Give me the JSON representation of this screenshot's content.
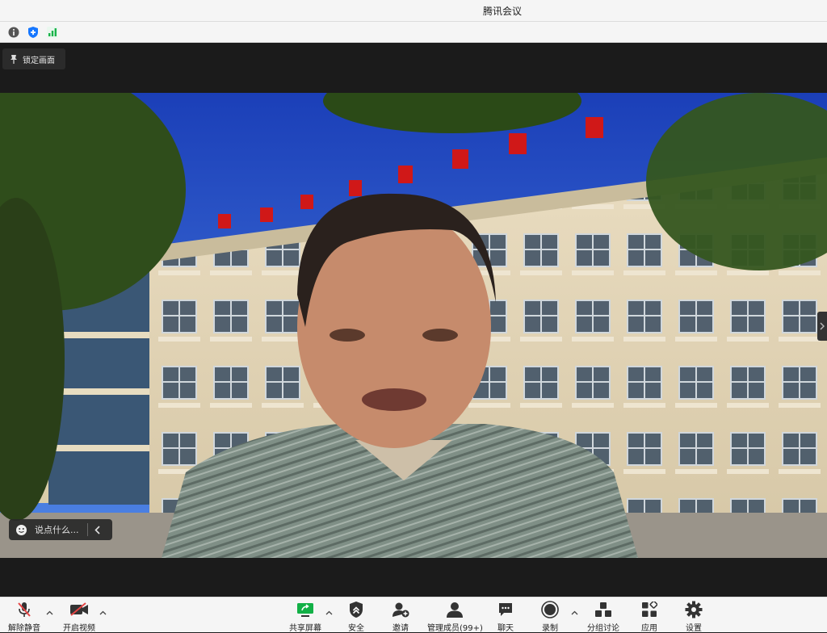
{
  "window": {
    "title": "腾讯会议"
  },
  "status_icons": [
    "info-icon",
    "shield-icon",
    "signal-bars-icon"
  ],
  "stage": {
    "lock_label": "锁定画面",
    "chat_placeholder": "说点什么..."
  },
  "toolbar": {
    "unmute": "解除静音",
    "start_video": "开启视频",
    "share_screen": "共享屏幕",
    "security": "安全",
    "invite": "邀请",
    "members": "管理成员(99+)",
    "chat": "聊天",
    "record": "录制",
    "breakout": "分组讨论",
    "apps": "应用",
    "settings": "设置"
  },
  "colors": {
    "share_green": "#12b046",
    "mute_red": "#e64545",
    "signal_green": "#19b34a",
    "shield_blue": "#1677ff"
  }
}
